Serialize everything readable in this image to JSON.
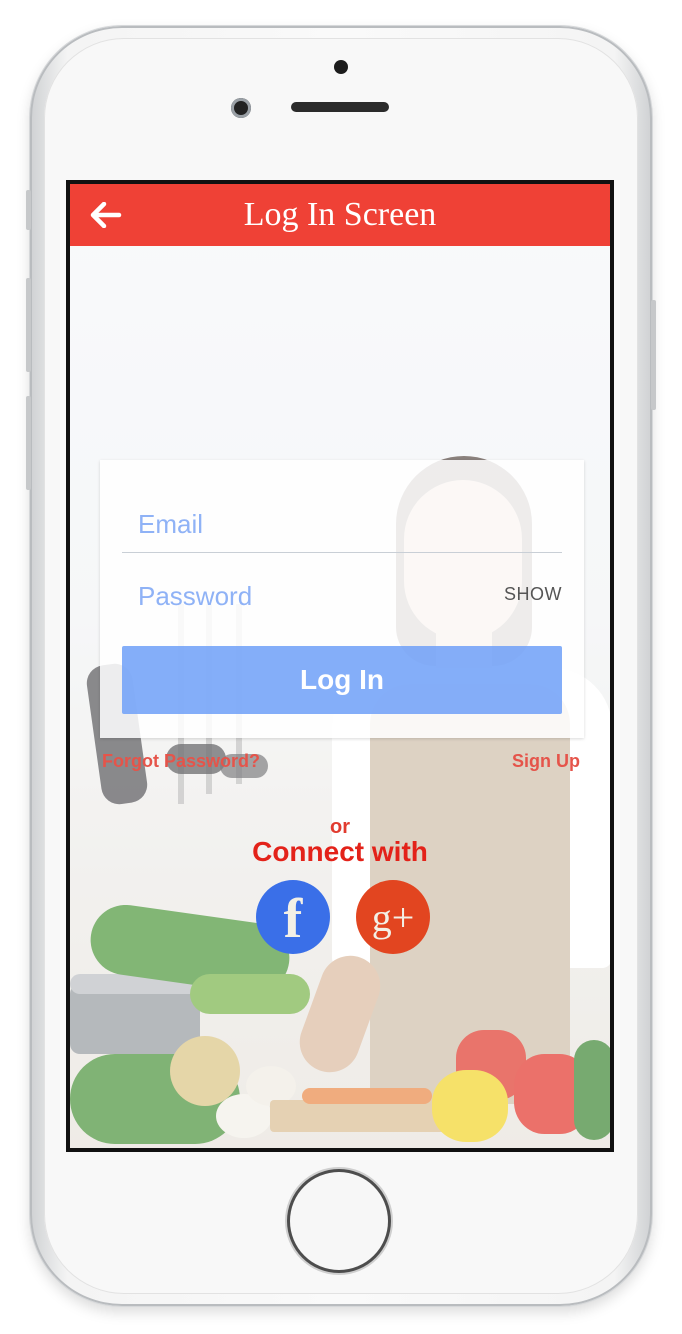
{
  "header": {
    "title": "Log In Screen",
    "back_icon": "arrow-left-icon"
  },
  "form": {
    "email_placeholder": "Email",
    "password_placeholder": "Password",
    "show_label": "SHOW",
    "login_label": "Log In"
  },
  "links": {
    "forgot": "Forgot Password?",
    "signup": "Sign Up"
  },
  "social": {
    "or": "or",
    "connect": "Connect with",
    "facebook_glyph": "f",
    "google_glyph": "g+"
  },
  "colors": {
    "header": "#ef4136",
    "button": "#6ea0f8",
    "facebook": "#3a6fe8",
    "google": "#e24520",
    "accent_text": "#e32219"
  }
}
